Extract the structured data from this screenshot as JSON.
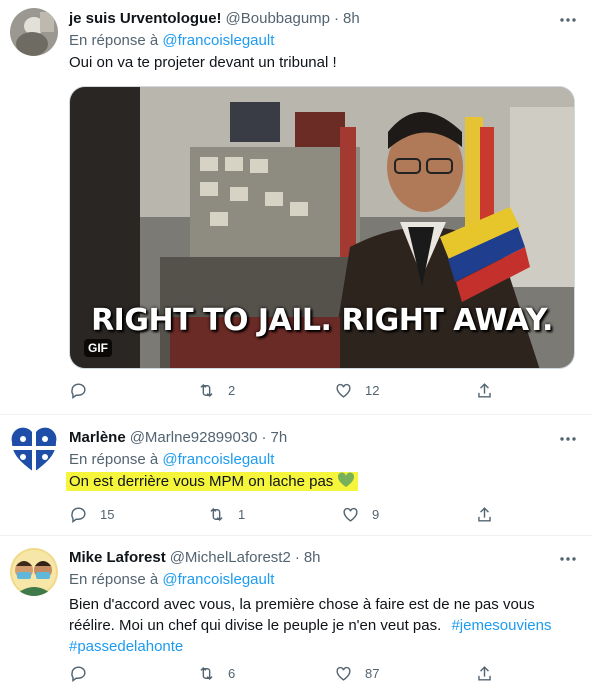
{
  "tweets": [
    {
      "name": "je suis Urventologue!",
      "handle": "@Boubbagump",
      "time": "8h",
      "reply_prefix": "En réponse à",
      "reply_to": "@francoislegault",
      "text": "Oui on va te projeter devant un tribunal !",
      "media": {
        "caption": "RIGHT TO JAIL. RIGHT AWAY.",
        "badge": "GIF"
      },
      "replies": "",
      "retweets": "2",
      "likes": "12"
    },
    {
      "name": "Marlène",
      "handle": "@Marlne92899030",
      "time": "7h",
      "reply_prefix": "En réponse à",
      "reply_to": "@francoislegault",
      "text": "On est derrière vous MPM on lache pas",
      "emoji": "green-heart",
      "replies": "15",
      "retweets": "1",
      "likes": "9"
    },
    {
      "name": "Mike Laforest",
      "handle": "@MichelLaforest2",
      "time": "8h",
      "reply_prefix": "En réponse à",
      "reply_to": "@francoislegault",
      "text_line1": "Bien d'accord avec vous, la première chose à faire est de ne pas vous",
      "text_line2": "réélire. Moi un chef qui divise le peuple je n'en veut pas.",
      "hashtag1": "#jemesouviens",
      "hashtag2": "#passedelahonte",
      "replies": "",
      "retweets": "6",
      "likes": "87"
    }
  ],
  "colors": {
    "accent": "#1d9bf0",
    "secondary_text": "#536471",
    "highlight": "#f5f53b",
    "heart_emoji": "#78b159"
  }
}
